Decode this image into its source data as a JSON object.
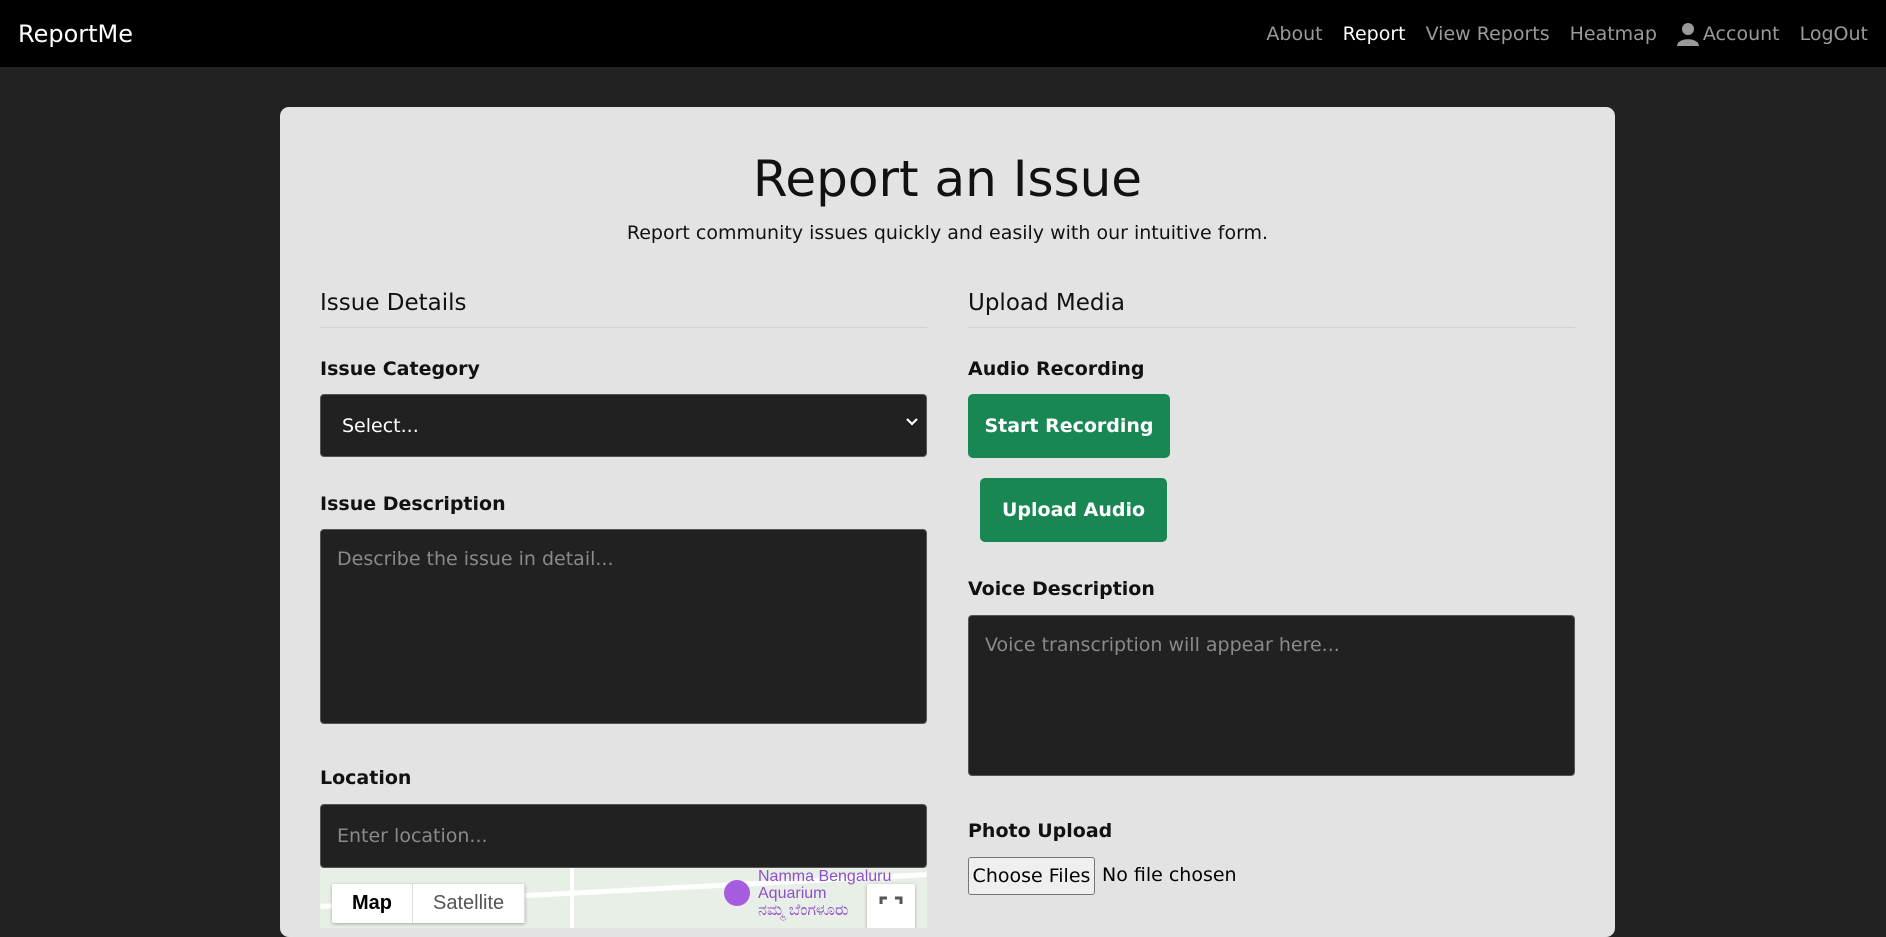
{
  "nav": {
    "brand": "ReportMe",
    "links": [
      "About",
      "Report",
      "View Reports",
      "Heatmap",
      "Account",
      "LogOut"
    ],
    "active": "Report"
  },
  "header": {
    "title": "Report an Issue",
    "subtitle": "Report community issues quickly and easily with our intuitive form."
  },
  "issue_details": {
    "heading": "Issue Details",
    "category_label": "Issue Category",
    "category_value": "Select...",
    "description_label": "Issue Description",
    "description_placeholder": "Describe the issue in detail...",
    "location_label": "Location",
    "location_placeholder": "Enter location..."
  },
  "map": {
    "tabs": [
      "Map",
      "Satellite"
    ],
    "active_tab": "Map",
    "poi_label": "Namma Bengaluru Aquarium",
    "poi_label_local": "ನಮ್ಮ ಬೆಂಗಳೂರು"
  },
  "upload_media": {
    "heading": "Upload Media",
    "audio_label": "Audio Recording",
    "start_recording": "Start Recording",
    "upload_audio": "Upload Audio",
    "voice_label": "Voice Description",
    "voice_placeholder": "Voice transcription will appear here...",
    "photo_label": "Photo Upload",
    "choose_files": "Choose Files",
    "file_status": "No file chosen"
  },
  "colors": {
    "navbar": "#000000",
    "page_bg": "#222222",
    "card_bg": "#e3e3e3",
    "field_bg": "#212121",
    "accent_green": "#198754"
  }
}
